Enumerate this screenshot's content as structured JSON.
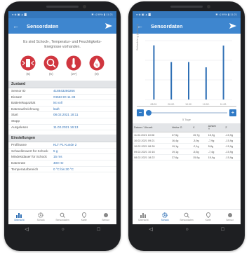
{
  "colors": {
    "appbar": "#3e86cf",
    "accent": "#2e6fb5",
    "alarm": "#d0363f"
  },
  "left": {
    "status_left": "●  ◈ ▣ ▲ ▇",
    "status_right": "✱ ◁ 99% ▮ 11:21",
    "title": "Sensordaten",
    "info": "Es sind Schock-, Temperatur- und Feuchtigkeits-Ereignisse vorhanden.",
    "events": [
      {
        "icon": "shock-alarm-icon",
        "count": "(5)"
      },
      {
        "icon": "search-alarm-icon",
        "count": "(5)"
      },
      {
        "icon": "temperature-alarm-icon",
        "count": "(27)"
      },
      {
        "icon": "humidity-alarm-icon",
        "count": "(8)"
      }
    ],
    "zustand_title": "Zustand",
    "zustand": [
      {
        "k": "Sensor ID",
        "v": "418843280266"
      },
      {
        "k": "Einsatz",
        "v": "#4563 ID 11-33"
      },
      {
        "k": "Batteriekapazität",
        "v": "ist voll"
      },
      {
        "k": "Datenaufzeichnung",
        "v": "läuft"
      },
      {
        "k": "Start",
        "v": "08.02.2021 18:11"
      },
      {
        "k": "Stopp",
        "v": ""
      },
      {
        "k": "Ausgelesen",
        "v": "11.02.2021 16:13"
      }
    ],
    "settings_title": "Einstellungen",
    "settings": [
      {
        "k": "Profilname",
        "v": "KLT P1 Kunde 2"
      },
      {
        "k": "Schwellenwert für Schock",
        "v": "5 g"
      },
      {
        "k": "Mindestdauer für Schock",
        "v": "15 ms"
      },
      {
        "k": "Datenrate",
        "v": "400 Hz"
      },
      {
        "k": "Temperaturbereich",
        "v": "0 °C bis 30 °C"
      }
    ],
    "nav": [
      "Übersicht",
      "Schock",
      "Sensordaten",
      "Karte",
      "Sensor"
    ],
    "active_nav": 0
  },
  "right": {
    "status_left": "●  ◈ ▣ ▲ ▇",
    "status_right": "✱ ◁ 99% ▮ 11:21",
    "title": "Sensordaten",
    "y_label": "Schock in g (Achsen)",
    "range_label": "5 Tage",
    "minus": "−",
    "plus": "+",
    "table_headers": [
      "Datum / Uhrzeit",
      "Vektor G",
      "X",
      "Y",
      "Z"
    ],
    "achsen_label": "Achsen",
    "rows": [
      [
        "11.02.2021 10:08",
        "27,5g",
        "15,7g",
        "15,9g",
        "-15,9g"
      ],
      [
        "10.02.2021 09:21",
        "16,4g",
        "-3,9g",
        "-7,9g",
        "-15,9g"
      ],
      [
        "10.02.2021 08:30",
        "19,1g",
        "-2,1g",
        "5,8g",
        "-15,9g"
      ],
      [
        "09.02.2021 10:16",
        "19,1g",
        "-5,5g",
        "-7,4g",
        "-15,9g"
      ],
      [
        "08.02.2021 18:22",
        "27,6g",
        "15,9g",
        "15,9g",
        "-15,9g"
      ]
    ],
    "nav": [
      "Übersicht",
      "Schock",
      "Sensordaten",
      "Karte",
      "Sensor"
    ],
    "active_nav": 1
  },
  "chart_data": {
    "type": "bar",
    "title": "",
    "xlabel": "",
    "ylabel": "Schock in g (Achsen)",
    "categories": [
      "08.02.",
      "09.02.",
      "10.02.",
      "10.02.",
      "11.02."
    ],
    "values": [
      27.6,
      19.1,
      19.1,
      16.4,
      27.5
    ],
    "ylim": [
      0,
      30
    ],
    "grid": true
  }
}
